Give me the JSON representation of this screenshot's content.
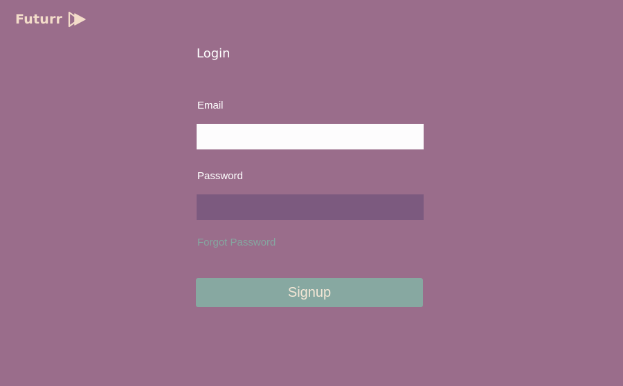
{
  "brand": {
    "name": "Futurr",
    "icon": "double-play-icon",
    "color": "#f3dcc9"
  },
  "form": {
    "title": "Login",
    "email_label": "Email",
    "email_value": "",
    "password_label": "Password",
    "password_value": "",
    "forgot_link": "Forgot Password",
    "submit_label": "Signup"
  },
  "colors": {
    "background": "#9a6d8b",
    "email_input_bg": "#fdfcfd",
    "password_input_bg": "#7c5a7f",
    "button_bg": "#87a8a1",
    "button_text": "#f4e7d6",
    "link": "#86a5a0"
  }
}
